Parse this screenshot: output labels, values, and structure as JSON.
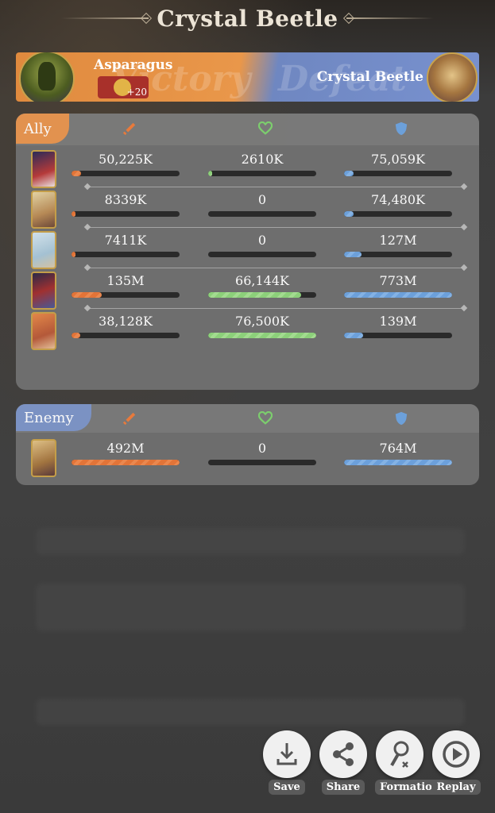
{
  "title": "Crystal Beetle",
  "banner": {
    "ally_name": "Asparagus",
    "badge_level": "+20",
    "enemy_name": "Crystal Beetle",
    "watermark_victory": "Victory",
    "watermark_defeat": "Defeat"
  },
  "ally_section": {
    "tag": "Ally",
    "header_icons": [
      "sword-icon",
      "heart-icon",
      "shield-icon"
    ],
    "rows": [
      {
        "damage": "50,225K",
        "healing": "2610K",
        "defense": "75,059K",
        "damage_fill": 0.09,
        "healing_fill": 0.03,
        "defense_fill": 0.09
      },
      {
        "damage": "8339K",
        "healing": "0",
        "defense": "74,480K",
        "damage_fill": 0.02,
        "healing_fill": 0,
        "defense_fill": 0.09
      },
      {
        "damage": "7411K",
        "healing": "0",
        "defense": "127M",
        "damage_fill": 0.02,
        "healing_fill": 0,
        "defense_fill": 0.16
      },
      {
        "damage": "135M",
        "healing": "66,144K",
        "defense": "773M",
        "damage_fill": 0.28,
        "healing_fill": 0.86,
        "defense_fill": 1.0
      },
      {
        "damage": "38,128K",
        "healing": "76,500K",
        "defense": "139M",
        "damage_fill": 0.08,
        "healing_fill": 1.0,
        "defense_fill": 0.18
      }
    ]
  },
  "enemy_section": {
    "tag": "Enemy",
    "header_icons": [
      "sword-icon",
      "heart-icon",
      "shield-icon"
    ],
    "rows": [
      {
        "damage": "492M",
        "healing": "0",
        "defense": "764M",
        "damage_fill": 1.0,
        "healing_fill": 0,
        "defense_fill": 1.0
      }
    ]
  },
  "actions": {
    "save": "Save",
    "share": "Share",
    "formation": "Formation",
    "replay": "Replay"
  },
  "colors": {
    "ally_accent": "#e89550",
    "enemy_accent": "#7d95c8",
    "damage": "#e87638",
    "healing": "#8fd57c",
    "defense": "#6ea4e0"
  }
}
